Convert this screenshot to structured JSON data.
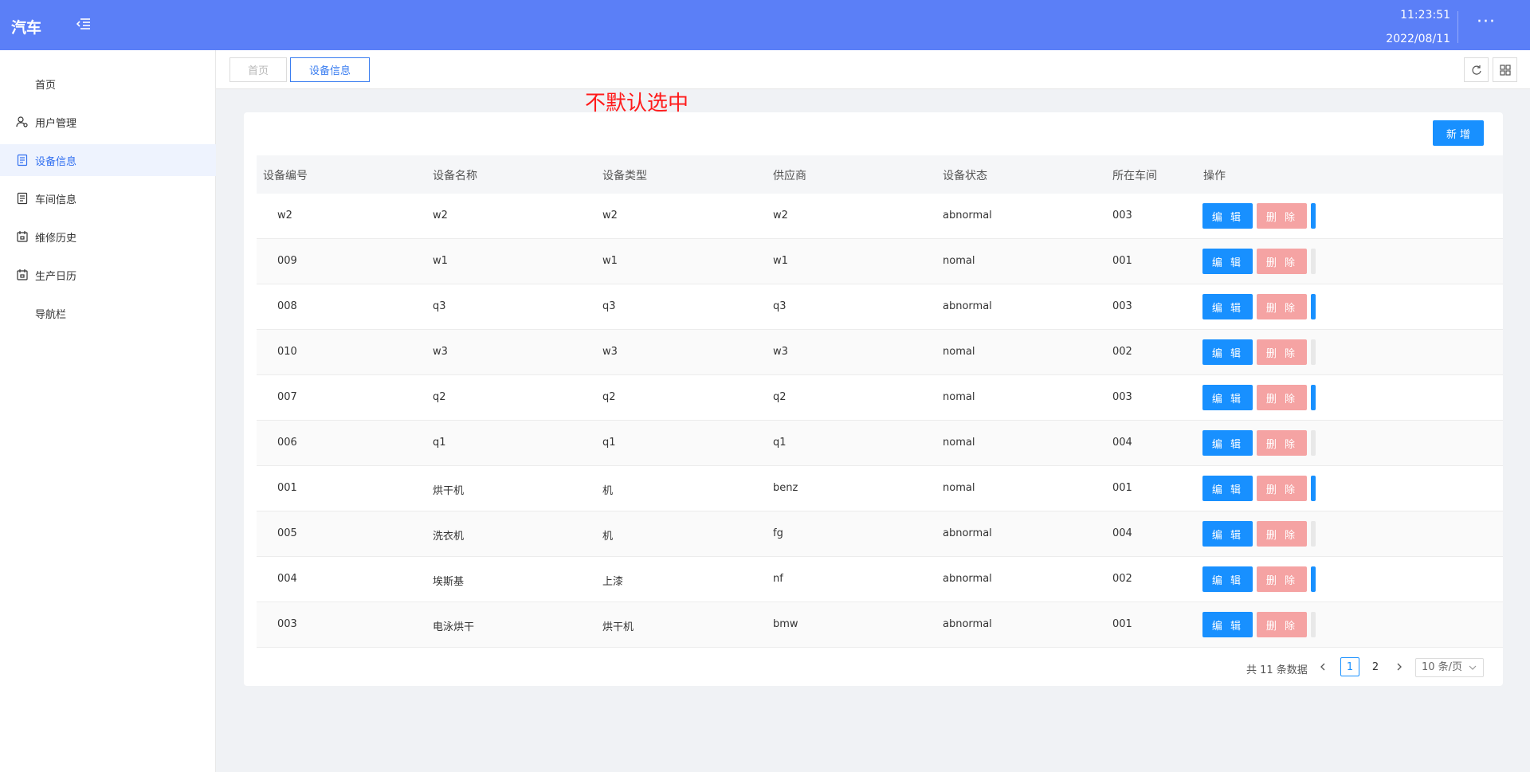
{
  "header": {
    "logo": "汽车",
    "time": "11:23:51",
    "date": "2022/08/11",
    "more": "···"
  },
  "sidebar": {
    "items": [
      {
        "label": "首页",
        "icon": "none"
      },
      {
        "label": "用户管理",
        "icon": "user-gear-icon"
      },
      {
        "label": "设备信息",
        "icon": "document-icon",
        "active": true
      },
      {
        "label": "车间信息",
        "icon": "document-icon"
      },
      {
        "label": "维修历史",
        "icon": "calendar-icon"
      },
      {
        "label": "生产日历",
        "icon": "calendar-icon"
      },
      {
        "label": "导航栏",
        "icon": "none"
      }
    ]
  },
  "tabs": [
    {
      "label": "首页"
    },
    {
      "label": "设备信息",
      "active": true
    }
  ],
  "annotation": "不默认选中",
  "toolbar": {
    "add_label": "新 增"
  },
  "table": {
    "columns": [
      "设备编号",
      "设备名称",
      "设备类型",
      "供应商",
      "设备状态",
      "所在车间",
      "操作"
    ],
    "rows": [
      [
        "w2",
        "w2",
        "w2",
        "w2",
        "abnormal",
        "003"
      ],
      [
        "009",
        "w1",
        "w1",
        "w1",
        "nomal",
        "001"
      ],
      [
        "008",
        "q3",
        "q3",
        "q3",
        "abnormal",
        "003"
      ],
      [
        "010",
        "w3",
        "w3",
        "w3",
        "nomal",
        "002"
      ],
      [
        "007",
        "q2",
        "q2",
        "q2",
        "nomal",
        "003"
      ],
      [
        "006",
        "q1",
        "q1",
        "q1",
        "nomal",
        "004"
      ],
      [
        "001",
        "烘干机",
        "机",
        "benz",
        "nomal",
        "001"
      ],
      [
        "005",
        "洗衣机",
        "机",
        "fg",
        "abnormal",
        "004"
      ],
      [
        "004",
        "埃斯基",
        "上漆",
        "nf",
        "abnormal",
        "002"
      ],
      [
        "003",
        "电泳烘干",
        "烘干机",
        "bmw",
        "abnormal",
        "001"
      ]
    ],
    "edit_label": "编 辑",
    "delete_label": "删 除"
  },
  "pagination": {
    "total": "共 11 条数据",
    "pages": [
      "1",
      "2"
    ],
    "current": "1",
    "page_size": "10 条/页"
  },
  "colors": {
    "header": "#5b7ff7",
    "primary": "#1890ff",
    "danger_light": "#f5a3a3",
    "annotation": "#ff1a1a"
  }
}
